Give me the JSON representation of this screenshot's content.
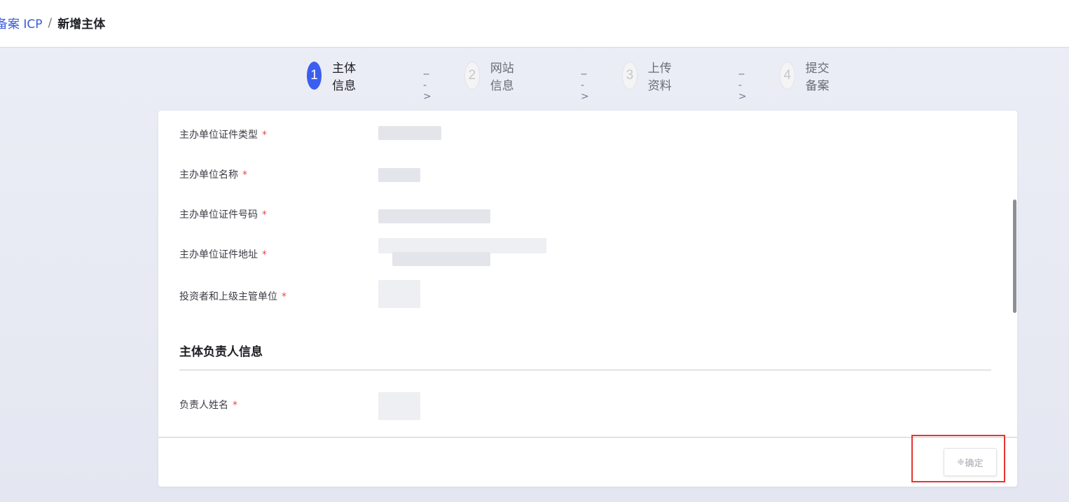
{
  "breadcrumb": {
    "parent": "备案 ICP",
    "separator": "/",
    "current": "新增主体"
  },
  "steps": [
    {
      "number": "1",
      "label": "主体信息",
      "state": "active"
    },
    {
      "number": "2",
      "label": "网站信息",
      "state": "inactive"
    },
    {
      "number": "3",
      "label": "上传资料",
      "state": "inactive"
    },
    {
      "number": "4",
      "label": "提交备案",
      "state": "inactive"
    }
  ],
  "step_arrow": "--->",
  "form": {
    "fields": [
      {
        "label": "主办单位证件类型",
        "required_mark": "*"
      },
      {
        "label": "主办单位名称",
        "required_mark": "*"
      },
      {
        "label": "主办单位证件号码",
        "required_mark": "*"
      },
      {
        "label": "主办单位证件地址",
        "required_mark": "*"
      },
      {
        "label": "投资者和上级主管单位",
        "required_mark": "*"
      }
    ],
    "section_title": "主体负责人信息",
    "section_fields": [
      {
        "label": "负责人姓名",
        "required_mark": "*"
      }
    ]
  },
  "footer": {
    "confirm_label": "确定",
    "confirm_state": "loading",
    "spinner_icon": "loading-spinner-icon"
  },
  "colors": {
    "primary": "#3b5ef0",
    "required": "#e64a4a",
    "highlight": "#e4352f"
  }
}
